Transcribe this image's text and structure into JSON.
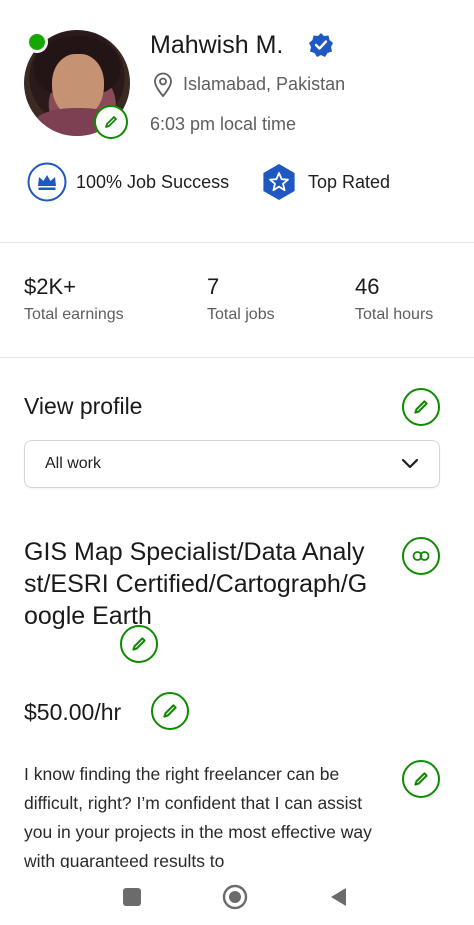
{
  "profile": {
    "name": "Mahwish M.",
    "location": "Islamabad, Pakistan",
    "local_time": "6:03 pm local time",
    "online": true,
    "job_success": "100% Job Success",
    "top_rated": "Top Rated"
  },
  "stats": [
    {
      "value": "$2K+",
      "label": "Total earnings"
    },
    {
      "value": "7",
      "label": "Total jobs"
    },
    {
      "value": "46",
      "label": "Total hours"
    }
  ],
  "view_profile": {
    "title": "View profile",
    "filter_selected": "All work"
  },
  "job": {
    "title": "GIS Map Specialist/Data Analyst/ESRI Certified/Cartograph/Google Earth",
    "rate": "$50.00/hr",
    "description": "I know finding the right freelancer can be difficult, right? I’m confident that I can assist you in your projects in the most effective way with guaranteed results to"
  },
  "colors": {
    "accent_green": "#108a00",
    "online_green": "#14a800",
    "badge_blue": "#1f57c3"
  },
  "icons": {
    "edit": "pencil-icon",
    "link": "link-icon",
    "location": "location-pin-icon",
    "verified": "verified-check-icon",
    "job_success": "crown-icon",
    "top_rated": "star-badge-icon"
  }
}
